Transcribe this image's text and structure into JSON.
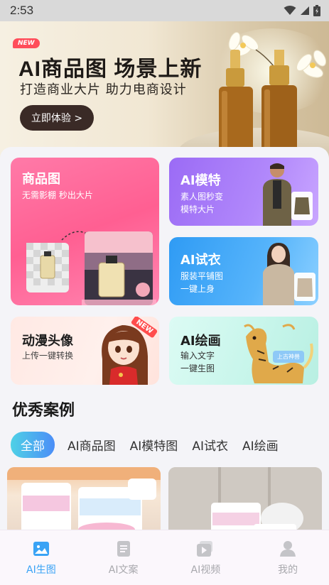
{
  "status_bar": {
    "time": "2:53"
  },
  "hero": {
    "badge": "NEW",
    "title": "AI商品图 场景上新",
    "subtitle": "打造商业大片 助力电商设计",
    "cta": "立即体验 >"
  },
  "tiles": {
    "product": {
      "title": "商品图",
      "desc": "无需影棚 秒出大片"
    },
    "model": {
      "title": "AI模特",
      "desc1": "素人图秒变",
      "desc2": "模特大片"
    },
    "tryon": {
      "title": "AI试衣",
      "desc1": "服装平铺图",
      "desc2": "一键上身"
    },
    "anime": {
      "title": "动漫头像",
      "desc": "上传一键转换",
      "badge": "NEW"
    },
    "draw": {
      "title": "AI绘画",
      "desc1": "输入文字",
      "desc2": "一键生图",
      "chip": "上古神兽"
    }
  },
  "cases": {
    "title": "优秀案例",
    "tabs": [
      "全部",
      "AI商品图",
      "AI模特图",
      "AI试衣",
      "AI绘画"
    ],
    "active_tab": "全部"
  },
  "bottom_nav": [
    {
      "label": "AI生图",
      "icon": "image-icon",
      "active": true
    },
    {
      "label": "AI文案",
      "icon": "document-icon",
      "active": false
    },
    {
      "label": "AI视频",
      "icon": "video-icon",
      "active": false
    },
    {
      "label": "我的",
      "icon": "person-icon",
      "active": false
    }
  ],
  "colors": {
    "accent": "#3aa3f5",
    "hero_button": "#3a2a26",
    "product_tile": "#ff6a9a",
    "model_tile": "#a676f8",
    "tryon_tile": "#45aaf8",
    "anime_tile": "#ffece7",
    "draw_tile": "#c9f6ec"
  }
}
